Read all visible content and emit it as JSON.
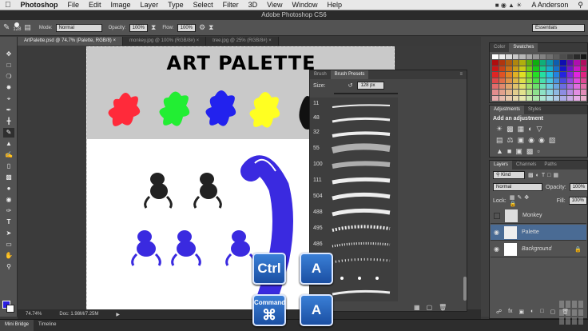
{
  "menubar": {
    "apple": "",
    "items": [
      "Photoshop",
      "File",
      "Edit",
      "Image",
      "Layer",
      "Type",
      "Select",
      "Filter",
      "3D",
      "View",
      "Window",
      "Help"
    ],
    "user": "A Anderson"
  },
  "window_title": "Adobe Photoshop CS6",
  "options": {
    "brush_size": "128",
    "mode_label": "Mode:",
    "mode_value": "Normal",
    "opacity_label": "Opacity:",
    "opacity_value": "100%",
    "flow_label": "Flow:",
    "flow_value": "100%",
    "workspace": "Essentials"
  },
  "tabs": [
    {
      "label": "ArtPalette.psd @ 74.7% (Palette, RGB/8)"
    },
    {
      "label": "monkey.jpg @ 100% (RGB/8#)"
    },
    {
      "label": "tree.jpg @ 25% (RGB/8#)"
    }
  ],
  "document": {
    "title": "ART PALETTE"
  },
  "status": {
    "zoom": "74.74%",
    "doc": "Doc: 1.98M/7.25M"
  },
  "bottom_tabs": [
    "Mini Bridge",
    "Timeline"
  ],
  "brush_panel": {
    "tabs": [
      "Brush",
      "Brush Presets"
    ],
    "size_label": "Size:",
    "size_value": "128 px",
    "numbers": [
      "11",
      "48",
      "32",
      "55",
      "100",
      "111",
      "504",
      "488",
      "495",
      "486",
      "463"
    ]
  },
  "right_panels": {
    "color_tabs": [
      "Color",
      "Swatches"
    ],
    "adjustments_tabs": [
      "Adjustments",
      "Styles"
    ],
    "add_adjustment": "Add an adjustment",
    "layers_tabs": [
      "Layers",
      "Channels",
      "Paths"
    ],
    "kind": "Kind",
    "blend": "Normal",
    "opacity_label": "Opacity:",
    "opacity_value": "100%",
    "lock_label": "Lock:",
    "fill_label": "Fill:",
    "fill_value": "100%",
    "layers": [
      "Monkey",
      "Palette",
      "Background"
    ]
  },
  "keys": {
    "ctrl": "Ctrl",
    "a": "A",
    "command": "Command",
    "command_symbol": "⌘"
  },
  "colors": {
    "splat_red": "#ff2a3a",
    "splat_green": "#22ee33",
    "splat_blue": "#2222ee",
    "splat_yellow": "#ffff22",
    "monkey_blue": "#3a2ae0"
  }
}
